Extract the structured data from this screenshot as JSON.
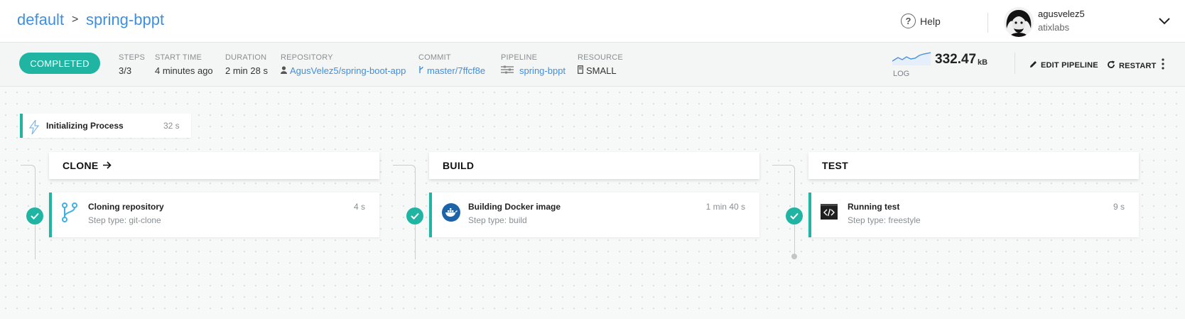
{
  "breadcrumb": {
    "project": "default",
    "separator": ">",
    "pipeline": "spring-bppt"
  },
  "header": {
    "help_label": "Help",
    "help_glyph": "?",
    "user": {
      "name": "agusvelez5",
      "org": "atixlabs"
    }
  },
  "build": {
    "status": "COMPLETED",
    "meta": {
      "steps": {
        "label": "STEPS",
        "value": "3/3"
      },
      "start_time": {
        "label": "START TIME",
        "value": "4 minutes ago"
      },
      "duration": {
        "label": "DURATION",
        "value": "2 min 28 s"
      },
      "repository": {
        "label": "REPOSITORY",
        "value": "AgusVelez5/spring-boot-app"
      },
      "commit": {
        "label": "COMMIT",
        "value": "master/7ffcf8e"
      },
      "pipeline": {
        "label": "PIPELINE",
        "value": "spring-bppt"
      },
      "resource": {
        "label": "RESOURCE",
        "value": "SMALL"
      }
    },
    "log": {
      "label": "LOG",
      "size": "332.47",
      "unit": "kB"
    },
    "actions": {
      "edit_pipeline": "EDIT PIPELINE",
      "restart": "RESTART"
    }
  },
  "init": {
    "title": "Initializing Process",
    "duration": "32 s"
  },
  "stages": [
    {
      "name": "CLONE",
      "step": {
        "title": "Cloning repository",
        "type": "Step type: git-clone",
        "duration": "4 s",
        "icon": "git-branch-icon"
      }
    },
    {
      "name": "BUILD",
      "step": {
        "title": "Building Docker image",
        "type": "Step type: build",
        "duration": "1 min 40 s",
        "icon": "docker-icon"
      }
    },
    {
      "name": "TEST",
      "step": {
        "title": "Running test",
        "type": "Step type: freestyle",
        "duration": "9 s",
        "icon": "terminal-icon"
      }
    }
  ],
  "colors": {
    "accent": "#1fb5a2",
    "link": "#3f8fe0"
  }
}
